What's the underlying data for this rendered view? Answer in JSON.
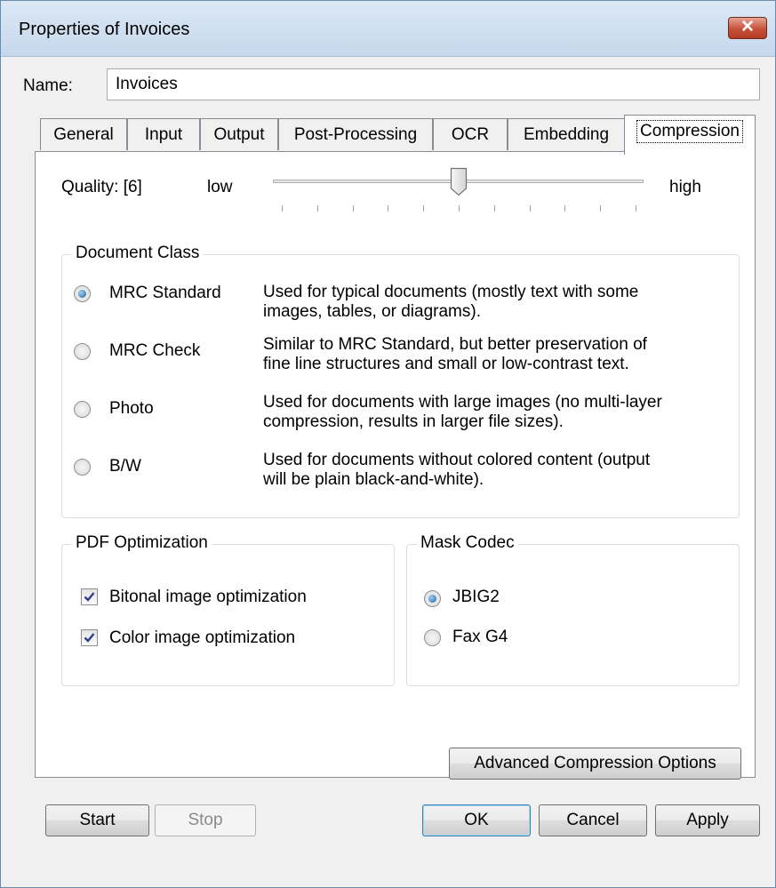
{
  "window": {
    "title": "Properties of Invoices",
    "close_icon": "✕"
  },
  "name_field": {
    "label": "Name:",
    "value": "Invoices"
  },
  "tabs": [
    {
      "label": "General"
    },
    {
      "label": "Input"
    },
    {
      "label": "Output"
    },
    {
      "label": "Post-Processing"
    },
    {
      "label": "OCR"
    },
    {
      "label": "Embedding"
    },
    {
      "label": "Compression",
      "selected": true
    }
  ],
  "quality": {
    "label": "Quality: [6]",
    "low_label": "low",
    "high_label": "high",
    "value": 6,
    "min": 1,
    "max": 11
  },
  "document_class": {
    "title": "Document Class",
    "options": [
      {
        "label": "MRC Standard",
        "selected": true,
        "desc_line1": "Used for typical documents (mostly text with some",
        "desc_line2": "images, tables, or diagrams)."
      },
      {
        "label": "MRC Check",
        "selected": false,
        "desc_line1": "Similar to MRC Standard, but better preservation of",
        "desc_line2": "fine line structures and small or low-contrast text."
      },
      {
        "label": "Photo",
        "selected": false,
        "desc_line1": "Used for documents with large images (no multi-layer",
        "desc_line2": "compression, results in larger file sizes)."
      },
      {
        "label": "B/W",
        "selected": false,
        "desc_line1": "Used for documents without colored content (output",
        "desc_line2": "will be plain black-and-white)."
      }
    ]
  },
  "pdf_optimization": {
    "title": "PDF Optimization",
    "options": [
      {
        "label": "Bitonal image optimization",
        "checked": true
      },
      {
        "label": "Color image optimization",
        "checked": true
      }
    ]
  },
  "mask_codec": {
    "title": "Mask Codec",
    "options": [
      {
        "label": "JBIG2",
        "selected": true
      },
      {
        "label": "Fax G4",
        "selected": false
      }
    ]
  },
  "advanced_button": "Advanced Compression Options",
  "footer": {
    "start": "Start",
    "stop": "Stop",
    "ok": "OK",
    "cancel": "Cancel",
    "apply": "Apply"
  },
  "colors": {
    "titlebar": "#c6d8ec",
    "close": "#c7503b",
    "radio_dot": "#1a5f9e",
    "check": "#2b3f8a"
  }
}
